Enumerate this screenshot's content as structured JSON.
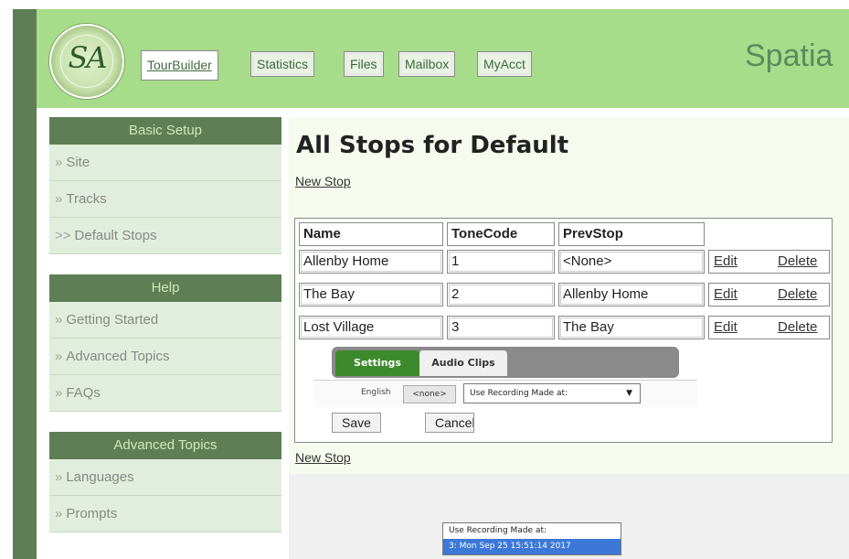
{
  "header": {
    "logo_text": "SA",
    "site_title": "Spatia",
    "nav_tabs": [
      {
        "label": "TourBuilder",
        "active": true
      },
      {
        "label": "Statistics",
        "active": false
      },
      {
        "label": "Files",
        "active": false
      },
      {
        "label": "Mailbox",
        "active": false
      },
      {
        "label": "MyAcct",
        "active": false
      }
    ]
  },
  "sidebar": {
    "sections": [
      {
        "title": "Basic Setup",
        "items": [
          {
            "label": "Site",
            "marker": "»"
          },
          {
            "label": "Tracks",
            "marker": "»"
          },
          {
            "label": "Default Stops",
            "marker": ">>"
          }
        ]
      },
      {
        "title": "Help",
        "items": [
          {
            "label": "Getting Started",
            "marker": "»"
          },
          {
            "label": "Advanced Topics",
            "marker": "»"
          },
          {
            "label": "FAQs",
            "marker": "»"
          }
        ]
      },
      {
        "title": "Advanced Topics",
        "items": [
          {
            "label": "Languages",
            "marker": "»"
          },
          {
            "label": "Prompts",
            "marker": "»"
          }
        ]
      }
    ]
  },
  "main": {
    "title": "All Stops for Default",
    "new_stop_label": "New Stop",
    "table": {
      "headers": [
        "Name",
        "ToneCode",
        "PrevStop"
      ],
      "rows": [
        {
          "name": "Allenby Home",
          "tonecode": "1",
          "prevstop": "<None>",
          "edit": "Edit",
          "delete": "Delete"
        },
        {
          "name": "The Bay",
          "tonecode": "2",
          "prevstop": "Allenby Home",
          "edit": "Edit",
          "delete": "Delete"
        },
        {
          "name": "Lost Village",
          "tonecode": "3",
          "prevstop": "The Bay",
          "edit": "Edit",
          "delete": "Delete"
        }
      ]
    },
    "editor": {
      "tabs": {
        "settings": "Settings",
        "audio": "Audio Clips"
      },
      "language_label": "English",
      "none_button": "<none>",
      "recording_select_value": "Use Recording Made at:",
      "recording_options": [
        "Use Recording Made at:",
        "3: Mon Sep 25 15:51:14 2017"
      ],
      "selected_option_index": 1,
      "save_label": "Save",
      "cancel_label": "Cancel"
    }
  },
  "colors": {
    "header_bg": "#a6dc8a",
    "sidebar_title_bg": "#5e7f55",
    "sidebar_item_bg": "#e2eedd",
    "main_bg": "#f5fcef",
    "settings_tab": "#3d8a2c",
    "selected_option": "#3c78d8"
  }
}
